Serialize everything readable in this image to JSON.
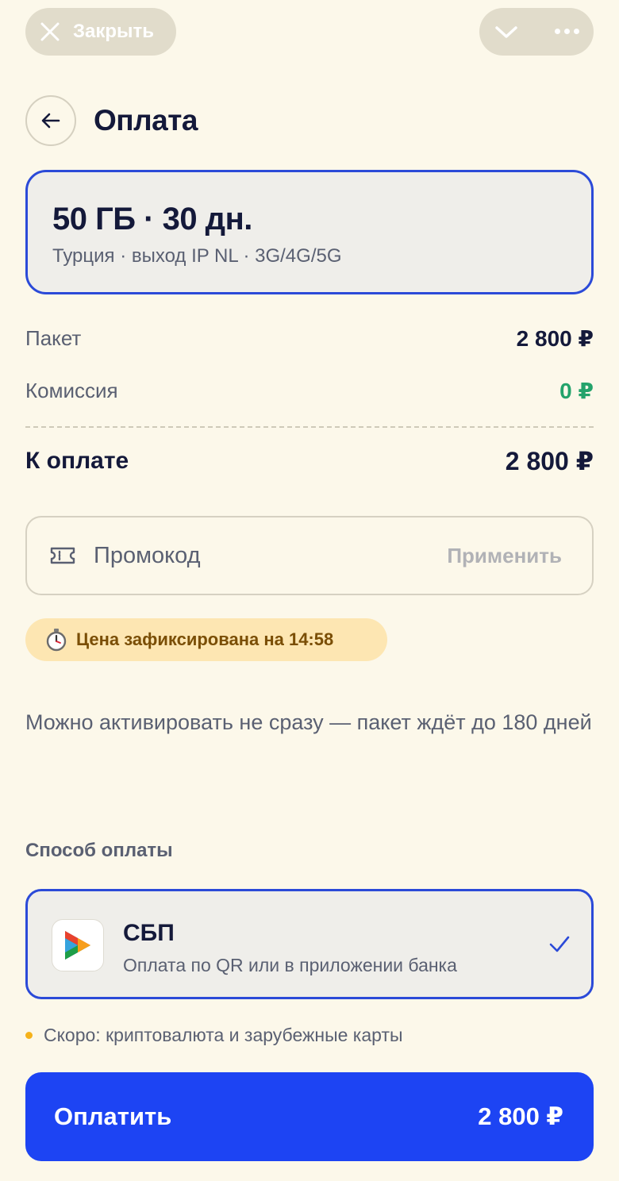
{
  "topbar": {
    "close_label": "Закрыть",
    "icons": [
      "close-icon",
      "chevron-down-icon",
      "more-dots-icon"
    ]
  },
  "header": {
    "title": "Оплата",
    "back_icon": "arrow-left-icon"
  },
  "plan": {
    "title": "50 ГБ · 30 дн.",
    "subtitle": "Турция · выход IP NL · 3G/4G/5G"
  },
  "summary": {
    "package_label": "Пакет",
    "package_value": "2 800 ₽",
    "fee_label": "Комиссия",
    "fee_value": "0 ₽",
    "total_label": "К оплате",
    "total_value": "2 800 ₽"
  },
  "promo": {
    "placeholder": "Промокод",
    "apply_label": "Применить",
    "icon": "ticket-icon"
  },
  "price_lock": {
    "text": "Цена зафиксирована на 14:58",
    "icon": "stopwatch-icon"
  },
  "note": "Можно активировать не сразу — пакет ждёт до 180 дней",
  "payment": {
    "section_label": "Способ оплаты",
    "method_name": "СБП",
    "method_desc": "Оплата по QR или в приложении банка",
    "selected": true
  },
  "soon_text": "Скоро: криптовалюта и зарубежные карты",
  "pay_button": {
    "label": "Оплатить",
    "amount": "2 800 ₽"
  },
  "colors": {
    "background": "#fcf8ea",
    "accent": "#1d44f3",
    "selected_border": "#2b4ad8",
    "success": "#23a36b",
    "badge_bg": "#fde6b2",
    "text_primary": "#14193a",
    "text_secondary": "#5a6072"
  }
}
